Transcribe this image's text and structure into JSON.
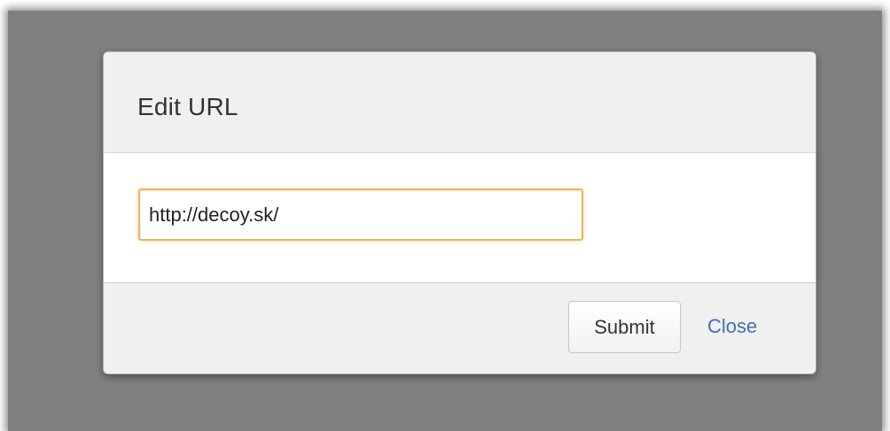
{
  "dialog": {
    "title": "Edit URL",
    "url_value": "http://decoy.sk/",
    "submit_label": "Submit",
    "close_label": "Close"
  },
  "colors": {
    "overlay": "#808080",
    "header_bg": "#f0f0f0",
    "input_focus_border": "#e8b855",
    "link": "#3d72b5"
  }
}
